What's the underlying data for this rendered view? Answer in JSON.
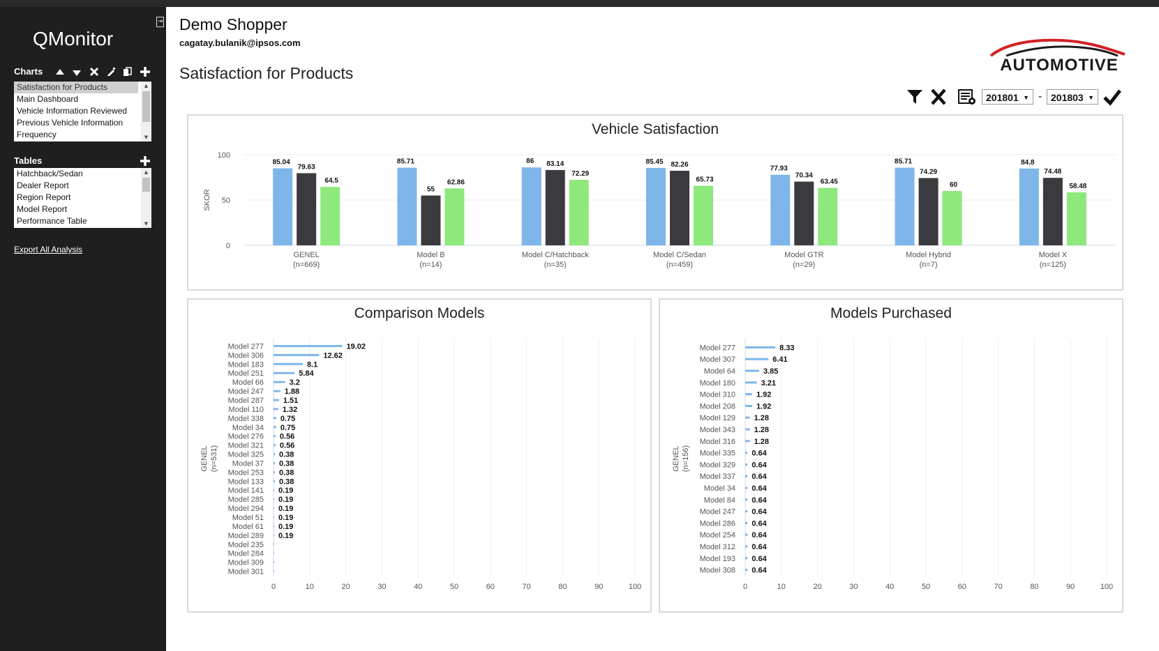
{
  "app": {
    "title": "QMonitor"
  },
  "sidebar": {
    "charts_heading": "Charts",
    "charts": [
      {
        "label": "Satisfaction for Products",
        "selected": true
      },
      {
        "label": "Main Dashboard"
      },
      {
        "label": "Vehicle Information Reviewed"
      },
      {
        "label": "Previous Vehicle Information"
      },
      {
        "label": "Frequency"
      }
    ],
    "tables_heading": "Tables",
    "tables": [
      {
        "label": "Hatchback/Sedan"
      },
      {
        "label": "Dealer Report"
      },
      {
        "label": "Region Report"
      },
      {
        "label": "Model Report"
      },
      {
        "label": "Performance Table"
      }
    ],
    "export_label": "Export All Analysis"
  },
  "header": {
    "user_name": "Demo Shopper",
    "user_email": "cagatay.bulanik@ipsos.com",
    "page_title": "Satisfaction for Products",
    "logo_text": "AUTOMOTIVE"
  },
  "filters": {
    "period_from": "201801",
    "period_to": "201803",
    "separator": "-"
  },
  "colors": {
    "blue": "#7eb6ea",
    "dark": "#3b3b3f",
    "green": "#8ee87c",
    "sidebar": "#1f1f1f"
  },
  "chart_data": [
    {
      "type": "bar",
      "title": "Vehicle Satisfaction",
      "ylabel": "SKOR",
      "ylim": [
        0,
        100
      ],
      "yticks": [
        0,
        50,
        100
      ],
      "categories": [
        "GENEL",
        "Model B",
        "Model C/Hatchback",
        "Model C/Sedan",
        "Model GTR",
        "Model Hybrid",
        "Model X"
      ],
      "category_sub": [
        "(n=669)",
        "(n=14)",
        "(n=35)",
        "(n=459)",
        "(n=29)",
        "(n=7)",
        "(n=125)"
      ],
      "series": [
        {
          "color": "#7eb6ea",
          "values": [
            85.04,
            85.71,
            86,
            85.45,
            77.93,
            85.71,
            84.8
          ],
          "labels": [
            "85.04",
            "85.71",
            "86",
            "85.45",
            "77.93",
            "85.71",
            "84.8"
          ]
        },
        {
          "color": "#3b3b3f",
          "values": [
            79.63,
            55,
            83.14,
            82.26,
            70.34,
            74.29,
            74.48
          ],
          "labels": [
            "79.63",
            "55",
            "83.14",
            "82.26",
            "70.34",
            "74.29",
            "74.48"
          ]
        },
        {
          "color": "#8ee87c",
          "values": [
            64.5,
            62.86,
            72.29,
            65.73,
            63.45,
            60,
            58.48
          ],
          "labels": [
            "64.5",
            "62.86",
            "72.29",
            "65.73",
            "63.45",
            "60",
            "58.48"
          ]
        }
      ],
      "grid": true
    },
    {
      "type": "bar",
      "orientation": "horizontal",
      "title": "Comparison Models",
      "ylabel": "GENEL",
      "ylabel_sub": "(n=531)",
      "xlim": [
        0,
        100
      ],
      "xticks": [
        0,
        10,
        20,
        30,
        40,
        50,
        60,
        70,
        80,
        90,
        100
      ],
      "categories": [
        "Model 277",
        "Model 306",
        "Model 183",
        "Model 251",
        "Model 66",
        "Model 247",
        "Model 287",
        "Model 110",
        "Model 338",
        "Model 34",
        "Model 276",
        "Model 321",
        "Model 325",
        "Model 37",
        "Model 253",
        "Model 133",
        "Model 141",
        "Model 285",
        "Model 294",
        "Model 51",
        "Model 61",
        "Model 289",
        "Model 235",
        "Model 284",
        "Model 309",
        "Model 301"
      ],
      "values": [
        19.02,
        12.62,
        8.1,
        5.84,
        3.2,
        1.88,
        1.51,
        1.32,
        0.75,
        0.75,
        0.56,
        0.56,
        0.38,
        0.38,
        0.38,
        0.38,
        0.19,
        0.19,
        0.19,
        0.19,
        0.19,
        0.19,
        0.19,
        0.19,
        0.19,
        0.19
      ],
      "data_labels": [
        "19.02",
        "12.62",
        "8.1",
        "5.84",
        "3.2",
        "1.88",
        "1.51",
        "1.32",
        "0.75",
        "0.75",
        "0.56",
        "0.56",
        "0.38",
        "0.38",
        "0.38",
        "0.38",
        "0.19",
        "0.19",
        "0.19",
        "0.19",
        "0.19",
        "0.19"
      ],
      "color": "#7eb6ea",
      "grid": true
    },
    {
      "type": "bar",
      "orientation": "horizontal",
      "title": "Models Purchased",
      "ylabel": "GENEL",
      "ylabel_sub": "(n=156)",
      "xlim": [
        0,
        100
      ],
      "xticks": [
        0,
        10,
        20,
        30,
        40,
        50,
        60,
        70,
        80,
        90,
        100
      ],
      "categories": [
        "Model 277",
        "Model 307",
        "Model 64",
        "Model 180",
        "Model 310",
        "Model 208",
        "Model 129",
        "Model 343",
        "Model 316",
        "Model 335",
        "Model 329",
        "Model 337",
        "Model 34",
        "Model 84",
        "Model 247",
        "Model 286",
        "Model 254",
        "Model 312",
        "Model 193",
        "Model 308"
      ],
      "values": [
        8.33,
        6.41,
        3.85,
        3.21,
        1.92,
        1.92,
        1.28,
        1.28,
        1.28,
        0.64,
        0.64,
        0.64,
        0.64,
        0.64,
        0.64,
        0.64,
        0.64,
        0.64,
        0.64,
        0.64
      ],
      "data_labels": [
        "8.33",
        "6.41",
        "3.85",
        "3.21",
        "1.92",
        "1.92",
        "1.28",
        "1.28",
        "1.28",
        "0.64",
        "0.64",
        "0.64",
        "0.64",
        "0.64",
        "0.64",
        "0.64",
        "0.64",
        "0.64",
        "0.64",
        "0.64"
      ],
      "color": "#7eb6ea",
      "grid": true
    }
  ]
}
